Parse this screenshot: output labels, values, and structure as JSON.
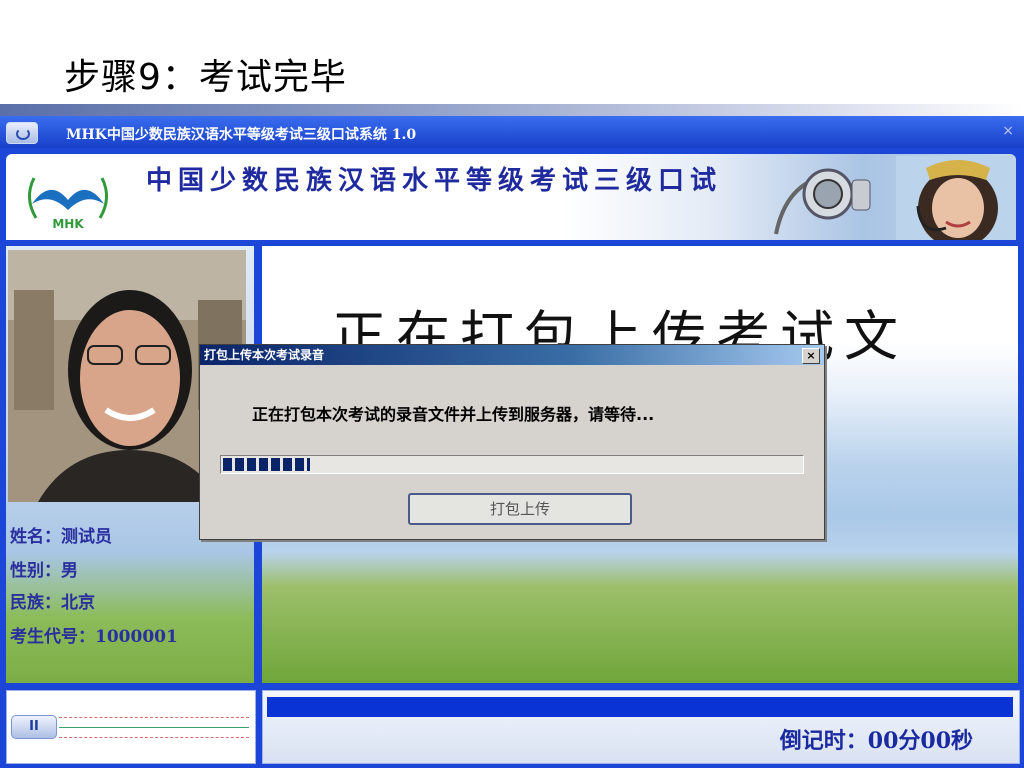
{
  "slide": {
    "title": "步骤9：考试完毕"
  },
  "app": {
    "window_title": "MHK中国少数民族汉语水平等级考试三级口试系统 1.0",
    "close_glyph": "×",
    "banner_title": "中国少数民族汉语水平等级考试三级口试",
    "logo_text": "MHK",
    "main_text": "正在打包上传考试文",
    "candidate": {
      "name": "姓名：测试员",
      "gender": "性别：男",
      "ethnicity": "民族：北京",
      "exam_id": "考生代号：1000001"
    },
    "player_button": "II",
    "countdown": "倒记时：00分00秒"
  },
  "dialog": {
    "title": "打包上传本次考试录音",
    "close_glyph": "×",
    "message": "正在打包本次考试的录音文件并上传到服务器，请等待...",
    "progress_fraction": 0.15,
    "button_label": "打包上传"
  }
}
